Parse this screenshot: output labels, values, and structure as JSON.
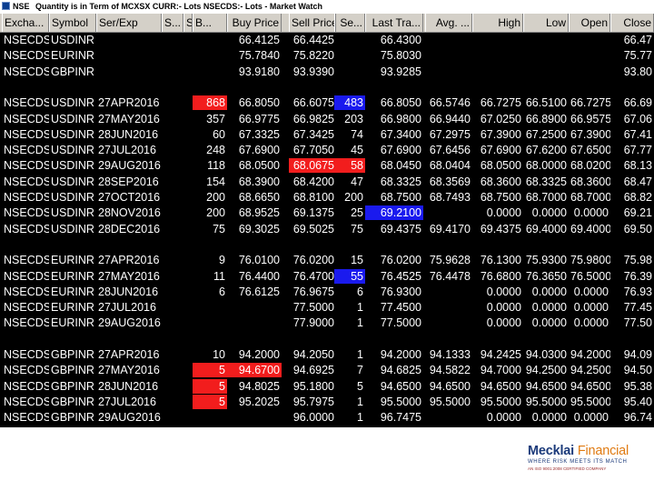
{
  "window": {
    "app_label": "NSE",
    "title": "Quantity is in Term of MCXSX CURR:- Lots NSECDS:- Lots - Market Watch"
  },
  "columns": [
    "Excha...",
    "Symbol",
    "Ser/Exp",
    "S...",
    "S",
    "B...",
    "Buy Price",
    "Sell Price",
    "Se...",
    "Last Tra...",
    "Avg. ...",
    "High",
    "Low",
    "Open",
    "Close"
  ],
  "rows": [
    {
      "cells": [
        "NSECDS",
        "USDINR",
        "",
        "",
        "",
        "",
        "66.4125",
        "66.4425",
        "",
        "66.4300",
        "",
        "",
        "",
        "",
        "66.47"
      ]
    },
    {
      "cells": [
        "NSECDS",
        "EURINR",
        "",
        "",
        "",
        "",
        "75.7840",
        "75.8220",
        "",
        "75.8030",
        "",
        "",
        "",
        "",
        "75.77"
      ]
    },
    {
      "cells": [
        "NSECDS",
        "GBPINR",
        "",
        "",
        "",
        "",
        "93.9180",
        "93.9390",
        "",
        "93.9285",
        "",
        "",
        "",
        "",
        "93.80"
      ]
    },
    {
      "cells": [
        "",
        "",
        "",
        "",
        "",
        "",
        "",
        "",
        "",
        "",
        "",
        "",
        "",
        "",
        ""
      ]
    },
    {
      "cells": [
        "NSECDS",
        "USDINR",
        "27APR2016",
        "",
        "",
        "868",
        "66.8050",
        "66.6075",
        "483",
        "66.8050",
        "66.5746",
        "66.7275",
        "66.5100",
        "66.7275",
        "66.69"
      ],
      "hl": {
        "5": "red",
        "8": "blue"
      }
    },
    {
      "cells": [
        "NSECDS",
        "USDINR",
        "27MAY2016",
        "",
        "",
        "357",
        "66.9775",
        "66.9825",
        "203",
        "66.9800",
        "66.9440",
        "67.0250",
        "66.8900",
        "66.9575",
        "67.06"
      ]
    },
    {
      "cells": [
        "NSECDS",
        "USDINR",
        "28JUN2016",
        "",
        "",
        "60",
        "67.3325",
        "67.3425",
        "74",
        "67.3400",
        "67.2975",
        "67.3900",
        "67.2500",
        "67.3900",
        "67.41"
      ]
    },
    {
      "cells": [
        "NSECDS",
        "USDINR",
        "27JUL2016",
        "",
        "",
        "248",
        "67.6900",
        "67.7050",
        "45",
        "67.6900",
        "67.6456",
        "67.6900",
        "67.6200",
        "67.6500",
        "67.77"
      ]
    },
    {
      "cells": [
        "NSECDS",
        "USDINR",
        "29AUG2016",
        "",
        "",
        "118",
        "68.0500",
        "68.0675",
        "58",
        "68.0450",
        "68.0404",
        "68.0500",
        "68.0000",
        "68.0200",
        "68.13"
      ],
      "hl": {
        "7": "red",
        "8": "red"
      }
    },
    {
      "cells": [
        "NSECDS",
        "USDINR",
        "28SEP2016",
        "",
        "",
        "154",
        "68.3900",
        "68.4200",
        "47",
        "68.3325",
        "68.3569",
        "68.3600",
        "68.3325",
        "68.3600",
        "68.47"
      ]
    },
    {
      "cells": [
        "NSECDS",
        "USDINR",
        "27OCT2016",
        "",
        "",
        "200",
        "68.6650",
        "68.8100",
        "200",
        "68.7500",
        "68.7493",
        "68.7500",
        "68.7000",
        "68.7000",
        "68.82"
      ]
    },
    {
      "cells": [
        "NSECDS",
        "USDINR",
        "28NOV2016",
        "",
        "",
        "200",
        "68.9525",
        "69.1375",
        "25",
        "69.2100",
        "",
        "0.0000",
        "0.0000",
        "0.0000",
        "69.21"
      ],
      "hl": {
        "9": "blue"
      }
    },
    {
      "cells": [
        "NSECDS",
        "USDINR",
        "28DEC2016",
        "",
        "",
        "75",
        "69.3025",
        "69.5025",
        "75",
        "69.4375",
        "69.4170",
        "69.4375",
        "69.4000",
        "69.4000",
        "69.50"
      ]
    },
    {
      "cells": [
        "",
        "",
        "",
        "",
        "",
        "",
        "",
        "",
        "",
        "",
        "",
        "",
        "",
        "",
        ""
      ]
    },
    {
      "cells": [
        "NSECDS",
        "EURINR",
        "27APR2016",
        "",
        "",
        "9",
        "76.0100",
        "76.0200",
        "15",
        "76.0200",
        "75.9628",
        "76.1300",
        "75.9300",
        "75.9800",
        "75.98"
      ]
    },
    {
      "cells": [
        "NSECDS",
        "EURINR",
        "27MAY2016",
        "",
        "",
        "11",
        "76.4400",
        "76.4700",
        "55",
        "76.4525",
        "76.4478",
        "76.6800",
        "76.3650",
        "76.5000",
        "76.39"
      ],
      "hl": {
        "8": "blue"
      }
    },
    {
      "cells": [
        "NSECDS",
        "EURINR",
        "28JUN2016",
        "",
        "",
        "6",
        "76.6125",
        "76.9675",
        "6",
        "76.9300",
        "",
        "0.0000",
        "0.0000",
        "0.0000",
        "76.93"
      ]
    },
    {
      "cells": [
        "NSECDS",
        "EURINR",
        "27JUL2016",
        "",
        "",
        "",
        "",
        "77.5000",
        "1",
        "77.4500",
        "",
        "0.0000",
        "0.0000",
        "0.0000",
        "77.45"
      ]
    },
    {
      "cells": [
        "NSECDS",
        "EURINR",
        "29AUG2016",
        "",
        "",
        "",
        "",
        "77.9000",
        "1",
        "77.5000",
        "",
        "0.0000",
        "0.0000",
        "0.0000",
        "77.50"
      ]
    },
    {
      "cells": [
        "",
        "",
        "",
        "",
        "",
        "",
        "",
        "",
        "",
        "",
        "",
        "",
        "",
        "",
        ""
      ]
    },
    {
      "cells": [
        "NSECDS",
        "GBPINR",
        "27APR2016",
        "",
        "",
        "10",
        "94.2000",
        "94.2050",
        "1",
        "94.2000",
        "94.1333",
        "94.2425",
        "94.0300",
        "94.2000",
        "94.09"
      ]
    },
    {
      "cells": [
        "NSECDS",
        "GBPINR",
        "27MAY2016",
        "",
        "",
        "5",
        "94.6700",
        "94.6925",
        "7",
        "94.6825",
        "94.5822",
        "94.7000",
        "94.2500",
        "94.2500",
        "94.50"
      ],
      "hl": {
        "5": "red",
        "6": "red"
      }
    },
    {
      "cells": [
        "NSECDS",
        "GBPINR",
        "28JUN2016",
        "",
        "",
        "5",
        "94.8025",
        "95.1800",
        "5",
        "94.6500",
        "94.6500",
        "94.6500",
        "94.6500",
        "94.6500",
        "95.38"
      ],
      "hl": {
        "5": "red"
      }
    },
    {
      "cells": [
        "NSECDS",
        "GBPINR",
        "27JUL2016",
        "",
        "",
        "5",
        "95.2025",
        "95.7975",
        "1",
        "95.5000",
        "95.5000",
        "95.5000",
        "95.5000",
        "95.5000",
        "95.40"
      ],
      "hl": {
        "5": "red"
      }
    },
    {
      "cells": [
        "NSECDS",
        "GBPINR",
        "29AUG2016",
        "",
        "",
        "",
        "",
        "96.0000",
        "1",
        "96.7475",
        "",
        "0.0000",
        "0.0000",
        "0.0000",
        "96.74"
      ]
    }
  ],
  "colors": {
    "background": "#000000",
    "text": "#ffffff",
    "highlight_red": "#f21d1d",
    "highlight_blue": "#1a1aee",
    "header": "#d4d0c8"
  },
  "logo": {
    "brand_main": "Mecklai",
    "brand_accent": "Financial",
    "tagline": "WHERE RISK MEETS ITS MATCH",
    "subline": "AN ISO 9001:2008 CERTIFIED COMPANY"
  }
}
